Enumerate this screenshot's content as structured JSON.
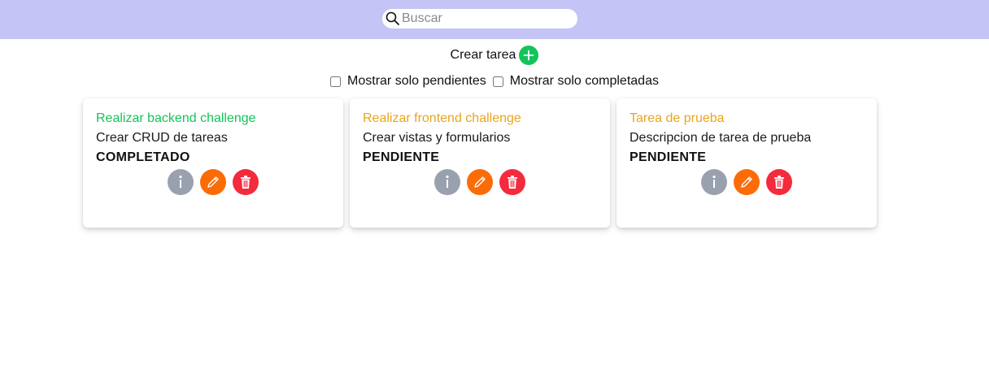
{
  "search": {
    "placeholder": "Buscar",
    "value": ""
  },
  "create": {
    "label": "Crear tarea"
  },
  "filters": {
    "pending_label": "Mostrar solo pendientes",
    "completed_label": "Mostrar solo completadas"
  },
  "colors": {
    "completed": "#13c45a",
    "pending": "#e8a51e",
    "topbar": "#c4c4f6"
  },
  "tasks": [
    {
      "title": "Realizar backend challenge",
      "description": "Crear CRUD de tareas",
      "status": "COMPLETADO"
    },
    {
      "title": "Realizar frontend challenge",
      "description": "Crear vistas y formularios",
      "status": "PENDIENTE"
    },
    {
      "title": "Tarea de prueba",
      "description": "Descripcion de tarea de prueba",
      "status": "PENDIENTE"
    }
  ],
  "icons": {
    "info": "info-icon",
    "edit": "pencil-icon",
    "delete": "trash-icon",
    "add": "plus-icon",
    "search": "search-icon"
  }
}
